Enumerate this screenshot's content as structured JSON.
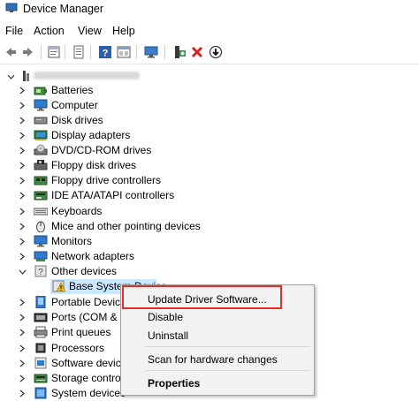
{
  "window": {
    "title": "Device Manager"
  },
  "menu": [
    "File",
    "Action",
    "View",
    "Help"
  ],
  "toolbar": [
    {
      "icon": "back-arrow-icon"
    },
    {
      "icon": "forward-arrow-icon"
    },
    {
      "icon": "properties-sheet-icon"
    },
    {
      "icon": "show-hide-tree-icon"
    },
    {
      "icon": "help-icon"
    },
    {
      "icon": "view-details-icon"
    },
    {
      "icon": "monitor-scan-icon"
    },
    {
      "icon": "add-driver-icon"
    },
    {
      "icon": "uninstall-x-icon"
    },
    {
      "icon": "update-driver-icon"
    }
  ],
  "tree": {
    "items": [
      {
        "label": "Batteries",
        "icon": "battery-icon",
        "expanded": false
      },
      {
        "label": "Computer",
        "icon": "computer-icon",
        "expanded": false
      },
      {
        "label": "Disk drives",
        "icon": "disk-drive-icon",
        "expanded": false
      },
      {
        "label": "Display adapters",
        "icon": "display-adapter-icon",
        "expanded": false
      },
      {
        "label": "DVD/CD-ROM drives",
        "icon": "dvd-drive-icon",
        "expanded": false
      },
      {
        "label": "Floppy disk drives",
        "icon": "floppy-disk-icon",
        "expanded": false
      },
      {
        "label": "Floppy drive controllers",
        "icon": "floppy-controller-icon",
        "expanded": false
      },
      {
        "label": "IDE ATA/ATAPI controllers",
        "icon": "ide-controller-icon",
        "expanded": false
      },
      {
        "label": "Keyboards",
        "icon": "keyboard-icon",
        "expanded": false
      },
      {
        "label": "Mice and other pointing devices",
        "icon": "mouse-icon",
        "expanded": false
      },
      {
        "label": "Monitors",
        "icon": "monitor-icon",
        "expanded": false
      },
      {
        "label": "Network adapters",
        "icon": "network-adapter-icon",
        "expanded": false
      },
      {
        "label": "Other devices",
        "icon": "other-devices-icon",
        "expanded": true
      },
      {
        "label": "Base System Device",
        "icon": "warning-device-icon",
        "child": true
      },
      {
        "label": "Portable Devices",
        "icon": "portable-device-icon",
        "expanded": false
      },
      {
        "label": "Ports (COM & LPT)",
        "icon": "port-icon",
        "expanded": false
      },
      {
        "label": "Print queues",
        "icon": "printer-icon",
        "expanded": false
      },
      {
        "label": "Processors",
        "icon": "processor-icon",
        "expanded": false
      },
      {
        "label": "Software devices",
        "icon": "software-device-icon",
        "expanded": false
      },
      {
        "label": "Storage controllers",
        "icon": "storage-controller-icon",
        "expanded": false
      },
      {
        "label": "System devices",
        "icon": "system-device-icon",
        "expanded": false
      }
    ]
  },
  "context_menu": {
    "update": "Update Driver Software...",
    "disable": "Disable",
    "uninstall": "Uninstall",
    "scan": "Scan for hardware changes",
    "properties": "Properties"
  },
  "colors": {
    "highlight_outline": "#e0302b",
    "selection": "#cce8ff"
  }
}
